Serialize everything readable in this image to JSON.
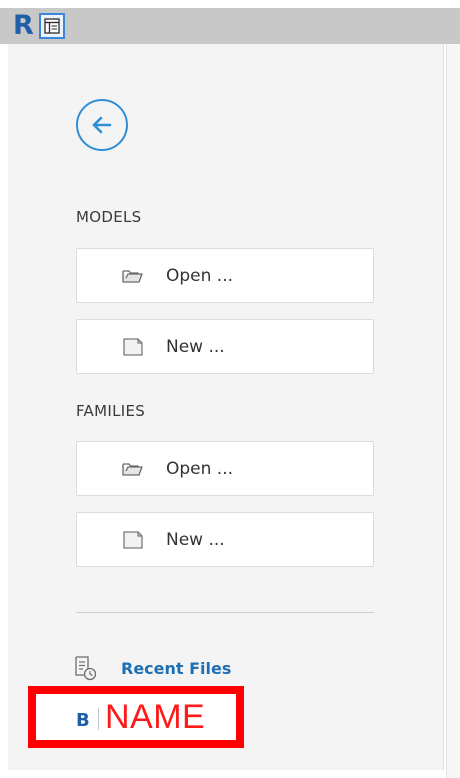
{
  "titlebar": {
    "logo_letter": "R",
    "toggle_icon": "panel-toggle-icon"
  },
  "back": {
    "icon": "arrow-left-icon"
  },
  "models": {
    "heading": "MODELS",
    "open_label": "Open ...",
    "new_label": "New ..."
  },
  "families": {
    "heading": "FAMILIES",
    "open_label": "Open ...",
    "new_label": "New ..."
  },
  "recent": {
    "label": "Recent Files",
    "icon": "recent-files-icon"
  },
  "name_box": {
    "b_letter": "B",
    "text": "NAME"
  },
  "colors": {
    "accent_blue": "#2f8fd6",
    "link_blue": "#1f6fb2",
    "highlight_red": "#ff0000"
  }
}
